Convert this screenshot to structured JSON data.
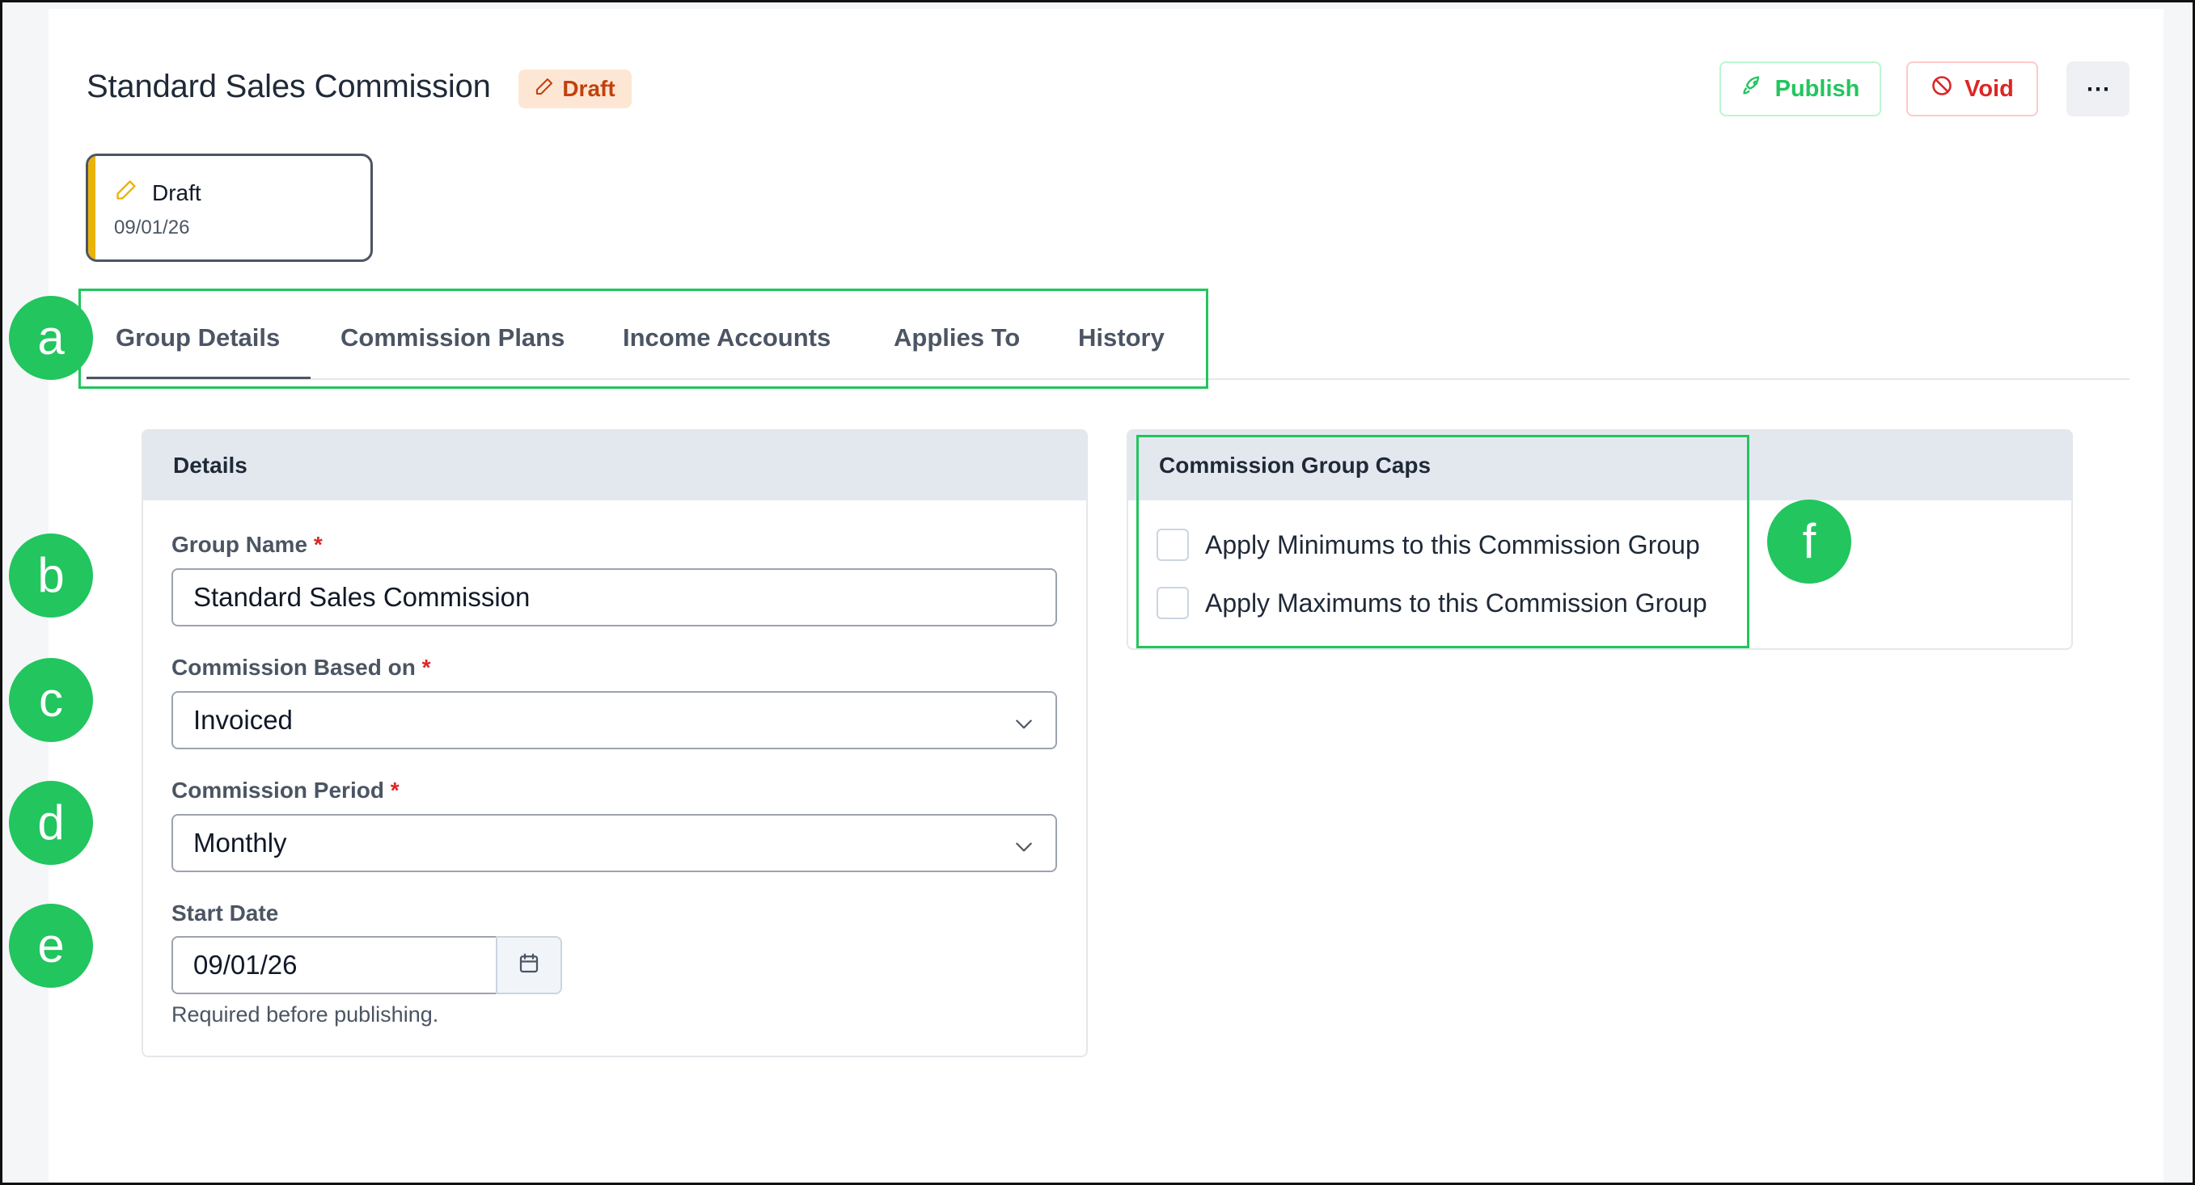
{
  "header": {
    "title": "Standard Sales Commission",
    "status_badge": "Draft",
    "actions": {
      "publish_label": "Publish",
      "void_label": "Void",
      "more_label": "⋯"
    }
  },
  "version_card": {
    "status": "Draft",
    "date": "09/01/26"
  },
  "tabs": [
    {
      "label": "Group Details",
      "active": true
    },
    {
      "label": "Commission Plans",
      "active": false
    },
    {
      "label": "Income Accounts",
      "active": false
    },
    {
      "label": "Applies To",
      "active": false
    },
    {
      "label": "History",
      "active": false
    }
  ],
  "details_panel": {
    "title": "Details",
    "group_name": {
      "label": "Group Name",
      "required_mark": "*",
      "value": "Standard Sales Commission"
    },
    "commission_based_on": {
      "label": "Commission Based on",
      "required_mark": "*",
      "value": "Invoiced"
    },
    "commission_period": {
      "label": "Commission Period",
      "required_mark": "*",
      "value": "Monthly"
    },
    "start_date": {
      "label": "Start Date",
      "value": "09/01/26",
      "help": "Required before publishing."
    }
  },
  "caps_panel": {
    "title": "Commission Group Caps",
    "options": [
      {
        "label": "Apply Minimums to this Commission Group",
        "checked": false
      },
      {
        "label": "Apply Maximums to this Commission Group",
        "checked": false
      }
    ]
  },
  "callouts": [
    "a",
    "b",
    "c",
    "d",
    "e",
    "f"
  ],
  "colors": {
    "callout_green": "#22c55e",
    "draft_badge_bg": "#fde7d4",
    "draft_badge_text": "#c2410c",
    "void_red": "#dc2626",
    "version_accent": "#eab308",
    "panel_header_bg": "#e3e8ef"
  },
  "icons": {
    "status_badge": "pencil-icon",
    "publish": "rocket-icon",
    "void": "ban-icon",
    "version": "pencil-icon",
    "select": "chevron-down-icon",
    "date": "calendar-icon"
  }
}
